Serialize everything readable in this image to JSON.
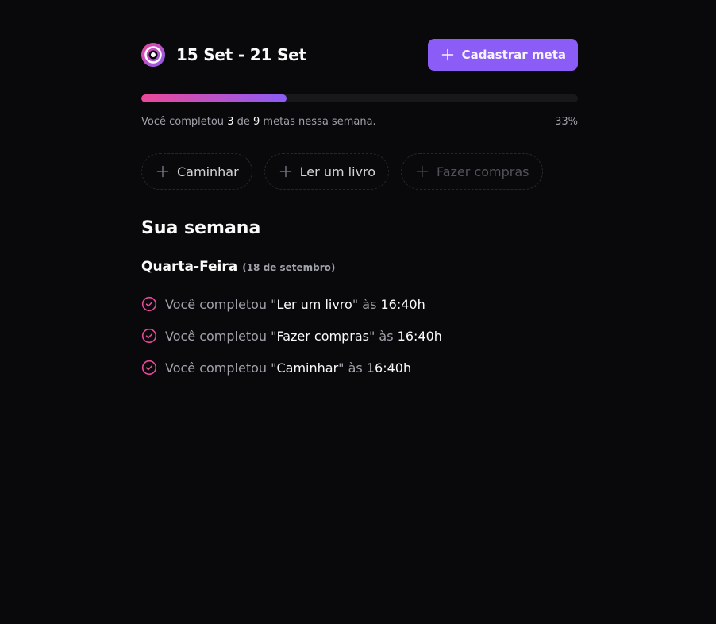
{
  "header": {
    "period": "15 Set - 21 Set",
    "create_button_label": "Cadastrar meta"
  },
  "progress": {
    "completed": "3",
    "total": "9",
    "text_prefix": "Você completou",
    "text_of": "de",
    "text_suffix": "metas nessa semana.",
    "percent_label": "33%",
    "fraction": 0.3333
  },
  "pending_goals": [
    {
      "label": "Caminhar",
      "disabled": false
    },
    {
      "label": "Ler um livro",
      "disabled": false
    },
    {
      "label": "Fazer compras",
      "disabled": true
    }
  ],
  "week": {
    "title": "Sua semana",
    "days": [
      {
        "name": "Quarta-Feira",
        "date": "(18 de setembro)",
        "activities": [
          {
            "prefix": "Você completou \"",
            "goal": "Ler um livro",
            "mid": "\" às ",
            "time": "16:40h"
          },
          {
            "prefix": "Você completou \"",
            "goal": "Fazer compras",
            "mid": "\" às ",
            "time": "16:40h"
          },
          {
            "prefix": "Você completou \"",
            "goal": "Caminhar",
            "mid": "\" às ",
            "time": "16:40h"
          }
        ]
      }
    ]
  },
  "colors": {
    "background": "#09090b",
    "accent_violet": "#8b5cf6",
    "accent_pink": "#ec4899",
    "track": "#18181b",
    "muted_text": "#a1a1aa"
  },
  "icons": {
    "logo": "in-orbit-logo-icon",
    "add": "plus-icon",
    "done": "check-circle-icon"
  }
}
